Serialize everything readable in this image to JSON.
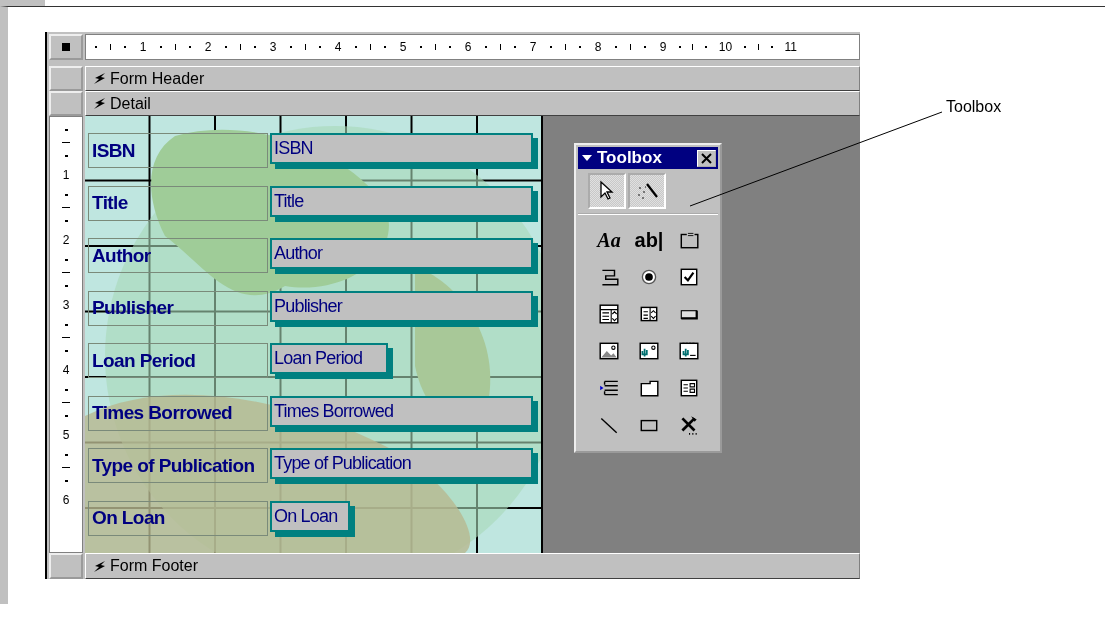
{
  "ruler": {
    "horizontal": [
      "1",
      "2",
      "3",
      "4",
      "5",
      "6",
      "7",
      "8",
      "9",
      "10",
      "11"
    ],
    "vertical": [
      "1",
      "2",
      "3",
      "4",
      "5",
      "6"
    ]
  },
  "sections": {
    "form_header": "Form Header",
    "detail": "Detail",
    "form_footer": "Form Footer"
  },
  "fields": [
    {
      "label": "ISBN",
      "control": "ISBN",
      "kind": "wide"
    },
    {
      "label": "Title",
      "control": "Title",
      "kind": "wide"
    },
    {
      "label": "Author",
      "control": "Author",
      "kind": "wide"
    },
    {
      "label": "Publisher",
      "control": "Publisher",
      "kind": "wide"
    },
    {
      "label": "Loan Period",
      "control": "Loan Period",
      "kind": "medium"
    },
    {
      "label": "Times Borrowed",
      "control": "Times Borrowed",
      "kind": "wide"
    },
    {
      "label": "Type of Publication",
      "control": "Type of Publication",
      "kind": "wide"
    },
    {
      "label": "On Loan",
      "control": "On Loan",
      "kind": "narrow"
    }
  ],
  "toolbox": {
    "title": "Toolbox",
    "toggles": [
      {
        "kind": "select",
        "pressed": true
      },
      {
        "kind": "wizard",
        "pressed": true
      }
    ],
    "tools": [
      {
        "kind": "label",
        "glyph": "Aa"
      },
      {
        "kind": "textbox",
        "glyph": "ab|"
      },
      {
        "kind": "option-group"
      },
      {
        "kind": "toggle"
      },
      {
        "kind": "radio"
      },
      {
        "kind": "checkbox"
      },
      {
        "kind": "combo"
      },
      {
        "kind": "listbox"
      },
      {
        "kind": "command"
      },
      {
        "kind": "image"
      },
      {
        "kind": "unbound-frame"
      },
      {
        "kind": "bound-frame"
      },
      {
        "kind": "page-break"
      },
      {
        "kind": "tab"
      },
      {
        "kind": "subform"
      },
      {
        "kind": "line"
      },
      {
        "kind": "rectangle"
      },
      {
        "kind": "more"
      }
    ]
  },
  "callout": "Toolbox"
}
